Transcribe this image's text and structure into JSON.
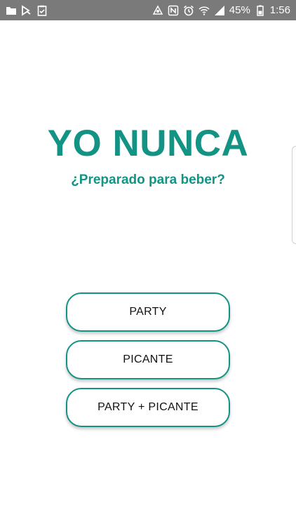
{
  "status_bar": {
    "battery_percent": "45%",
    "time": "1:56",
    "left_icons": [
      "folder-icon",
      "play-store-icon",
      "clipboard-check-icon"
    ],
    "right_icons": [
      "sync-icon",
      "nfc-icon",
      "alarm-icon",
      "wifi-icon",
      "signal-icon",
      "battery-icon"
    ]
  },
  "main": {
    "title": "YO NUNCA",
    "subtitle": "¿Preparado para beber?",
    "buttons": [
      {
        "label": "PARTY"
      },
      {
        "label": "PICANTE"
      },
      {
        "label": "PARTY + PICANTE"
      }
    ]
  },
  "colors": {
    "accent": "#129384",
    "status_bar": "#7a7a7a",
    "background": "#ffffff"
  }
}
